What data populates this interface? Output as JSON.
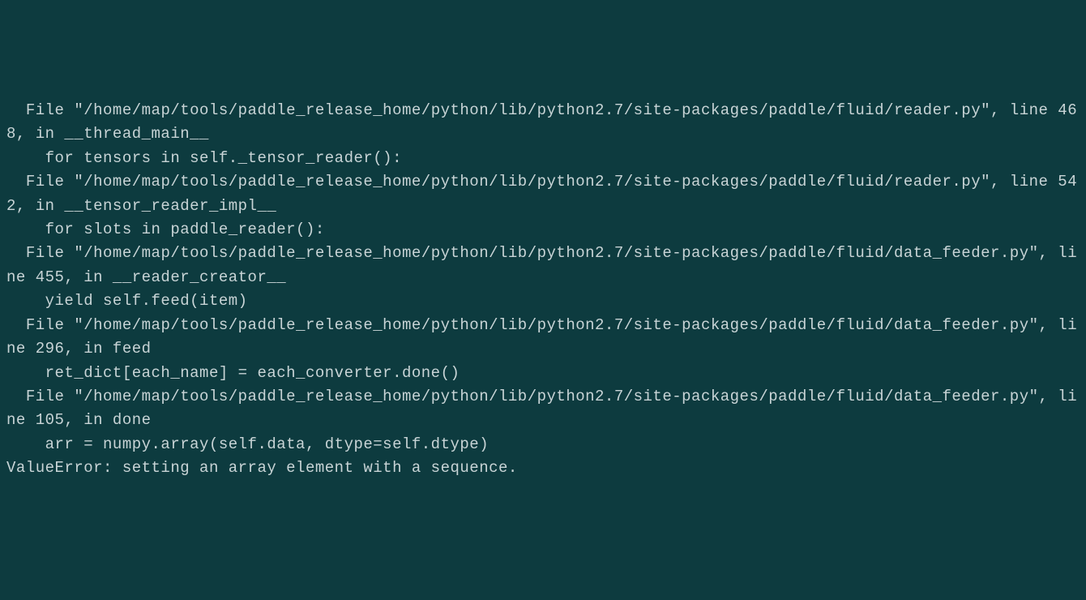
{
  "traceback": {
    "lines": [
      "  File \"/home/map/tools/paddle_release_home/python/lib/python2.7/site-packages/paddle/fluid/reader.py\", line 468, in __thread_main__",
      "    for tensors in self._tensor_reader():",
      "  File \"/home/map/tools/paddle_release_home/python/lib/python2.7/site-packages/paddle/fluid/reader.py\", line 542, in __tensor_reader_impl__",
      "    for slots in paddle_reader():",
      "  File \"/home/map/tools/paddle_release_home/python/lib/python2.7/site-packages/paddle/fluid/data_feeder.py\", line 455, in __reader_creator__",
      "    yield self.feed(item)",
      "  File \"/home/map/tools/paddle_release_home/python/lib/python2.7/site-packages/paddle/fluid/data_feeder.py\", line 296, in feed",
      "    ret_dict[each_name] = each_converter.done()",
      "  File \"/home/map/tools/paddle_release_home/python/lib/python2.7/site-packages/paddle/fluid/data_feeder.py\", line 105, in done",
      "    arr = numpy.array(self.data, dtype=self.dtype)",
      "ValueError: setting an array element with a sequence."
    ]
  }
}
